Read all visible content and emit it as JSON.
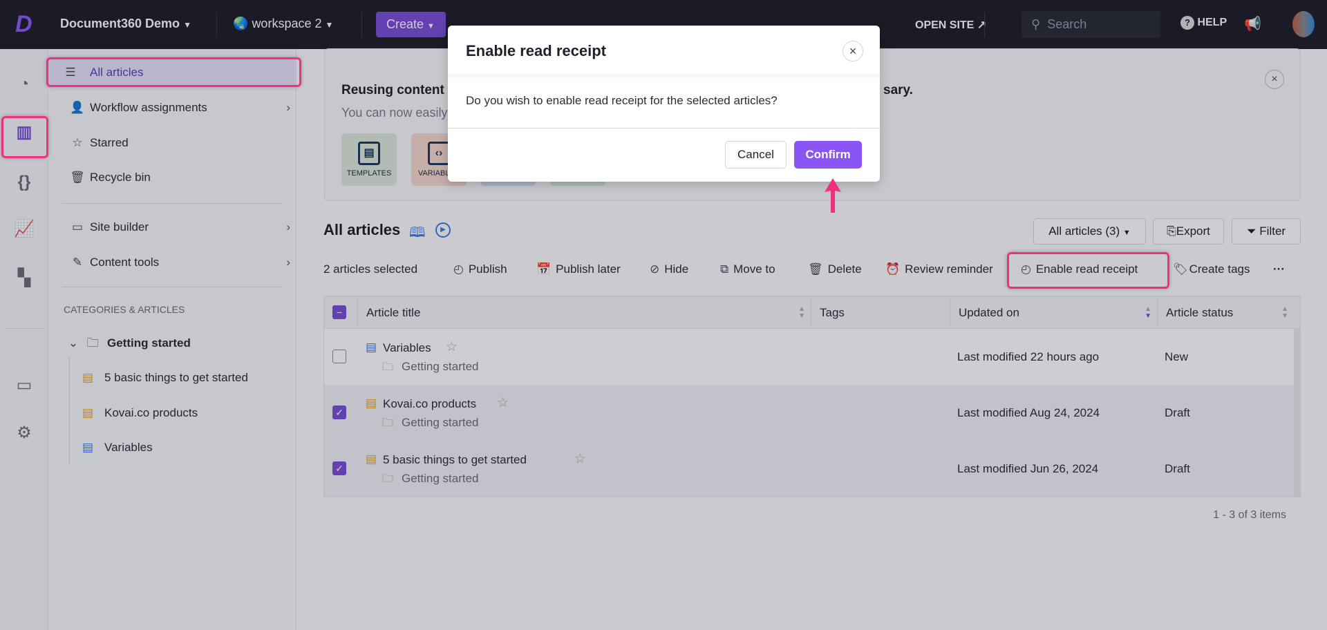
{
  "topbar": {
    "project": "Document360 Demo",
    "workspace": "workspace 2",
    "create": "Create",
    "open_site": "OPEN SITE",
    "search_placeholder": "Search",
    "help": "HELP"
  },
  "rail": {
    "icons": [
      "dashboard-icon",
      "documentation-icon",
      "api-icon",
      "analytics-icon",
      "widgets-icon",
      "drive-icon",
      "settings-icon"
    ]
  },
  "sidebar": {
    "items": [
      {
        "label": "All articles"
      },
      {
        "label": "Workflow assignments"
      },
      {
        "label": "Starred"
      },
      {
        "label": "Recycle bin"
      },
      {
        "label": "Site builder"
      },
      {
        "label": "Content tools"
      }
    ],
    "section": "CATEGORIES & ARTICLES",
    "category": "Getting started",
    "articles": [
      {
        "label": "5 basic things to get started"
      },
      {
        "label": "Kovai.co products"
      },
      {
        "label": "Variables"
      }
    ]
  },
  "banner": {
    "title_start": "Reusing content i",
    "title_end": "sary.",
    "subtitle": "You can now easily",
    "tiles": [
      {
        "label": "TEMPLATES",
        "color": "#dce8da"
      },
      {
        "label": "VARIABLES",
        "color": "#f6d8cc"
      },
      {
        "label": "",
        "color": "#d3def3"
      },
      {
        "label": "",
        "color": "#cfeadc"
      }
    ]
  },
  "main": {
    "title": "All articles",
    "view_select": "All articles (3)",
    "export": "Export",
    "filter": "Filter",
    "toolbar": {
      "selected": "2 articles selected",
      "publish": "Publish",
      "publish_later": "Publish later",
      "hide": "Hide",
      "move_to": "Move to",
      "delete": "Delete",
      "review_reminder": "Review reminder",
      "enable_read_receipt": "Enable read receipt",
      "create_tags": "Create tags",
      "more": "···"
    },
    "columns": [
      "Article title",
      "Tags",
      "Updated on",
      "Article status"
    ],
    "rows": [
      {
        "title": "Variables",
        "category": "Getting started",
        "updated": "Last modified 22 hours ago",
        "status": "New",
        "checked": false,
        "icon_color": "#3b7be8"
      },
      {
        "title": "Kovai.co products",
        "category": "Getting started",
        "updated": "Last modified Aug 24, 2024",
        "status": "Draft",
        "checked": true,
        "icon_color": "#e8a020"
      },
      {
        "title": "5 basic things to get started",
        "category": "Getting started",
        "updated": "Last modified Jun 26, 2024",
        "status": "Draft",
        "checked": true,
        "icon_color": "#e8a020"
      }
    ],
    "pagination": "1 - 3 of 3 items"
  },
  "dialog": {
    "title": "Enable read receipt",
    "message": "Do you wish to enable read receipt for the selected articles?",
    "cancel": "Cancel",
    "confirm": "Confirm"
  },
  "colors": {
    "accent": "#7b4fd6",
    "confirm": "#8b55f5",
    "highlight": "#f0307e"
  }
}
